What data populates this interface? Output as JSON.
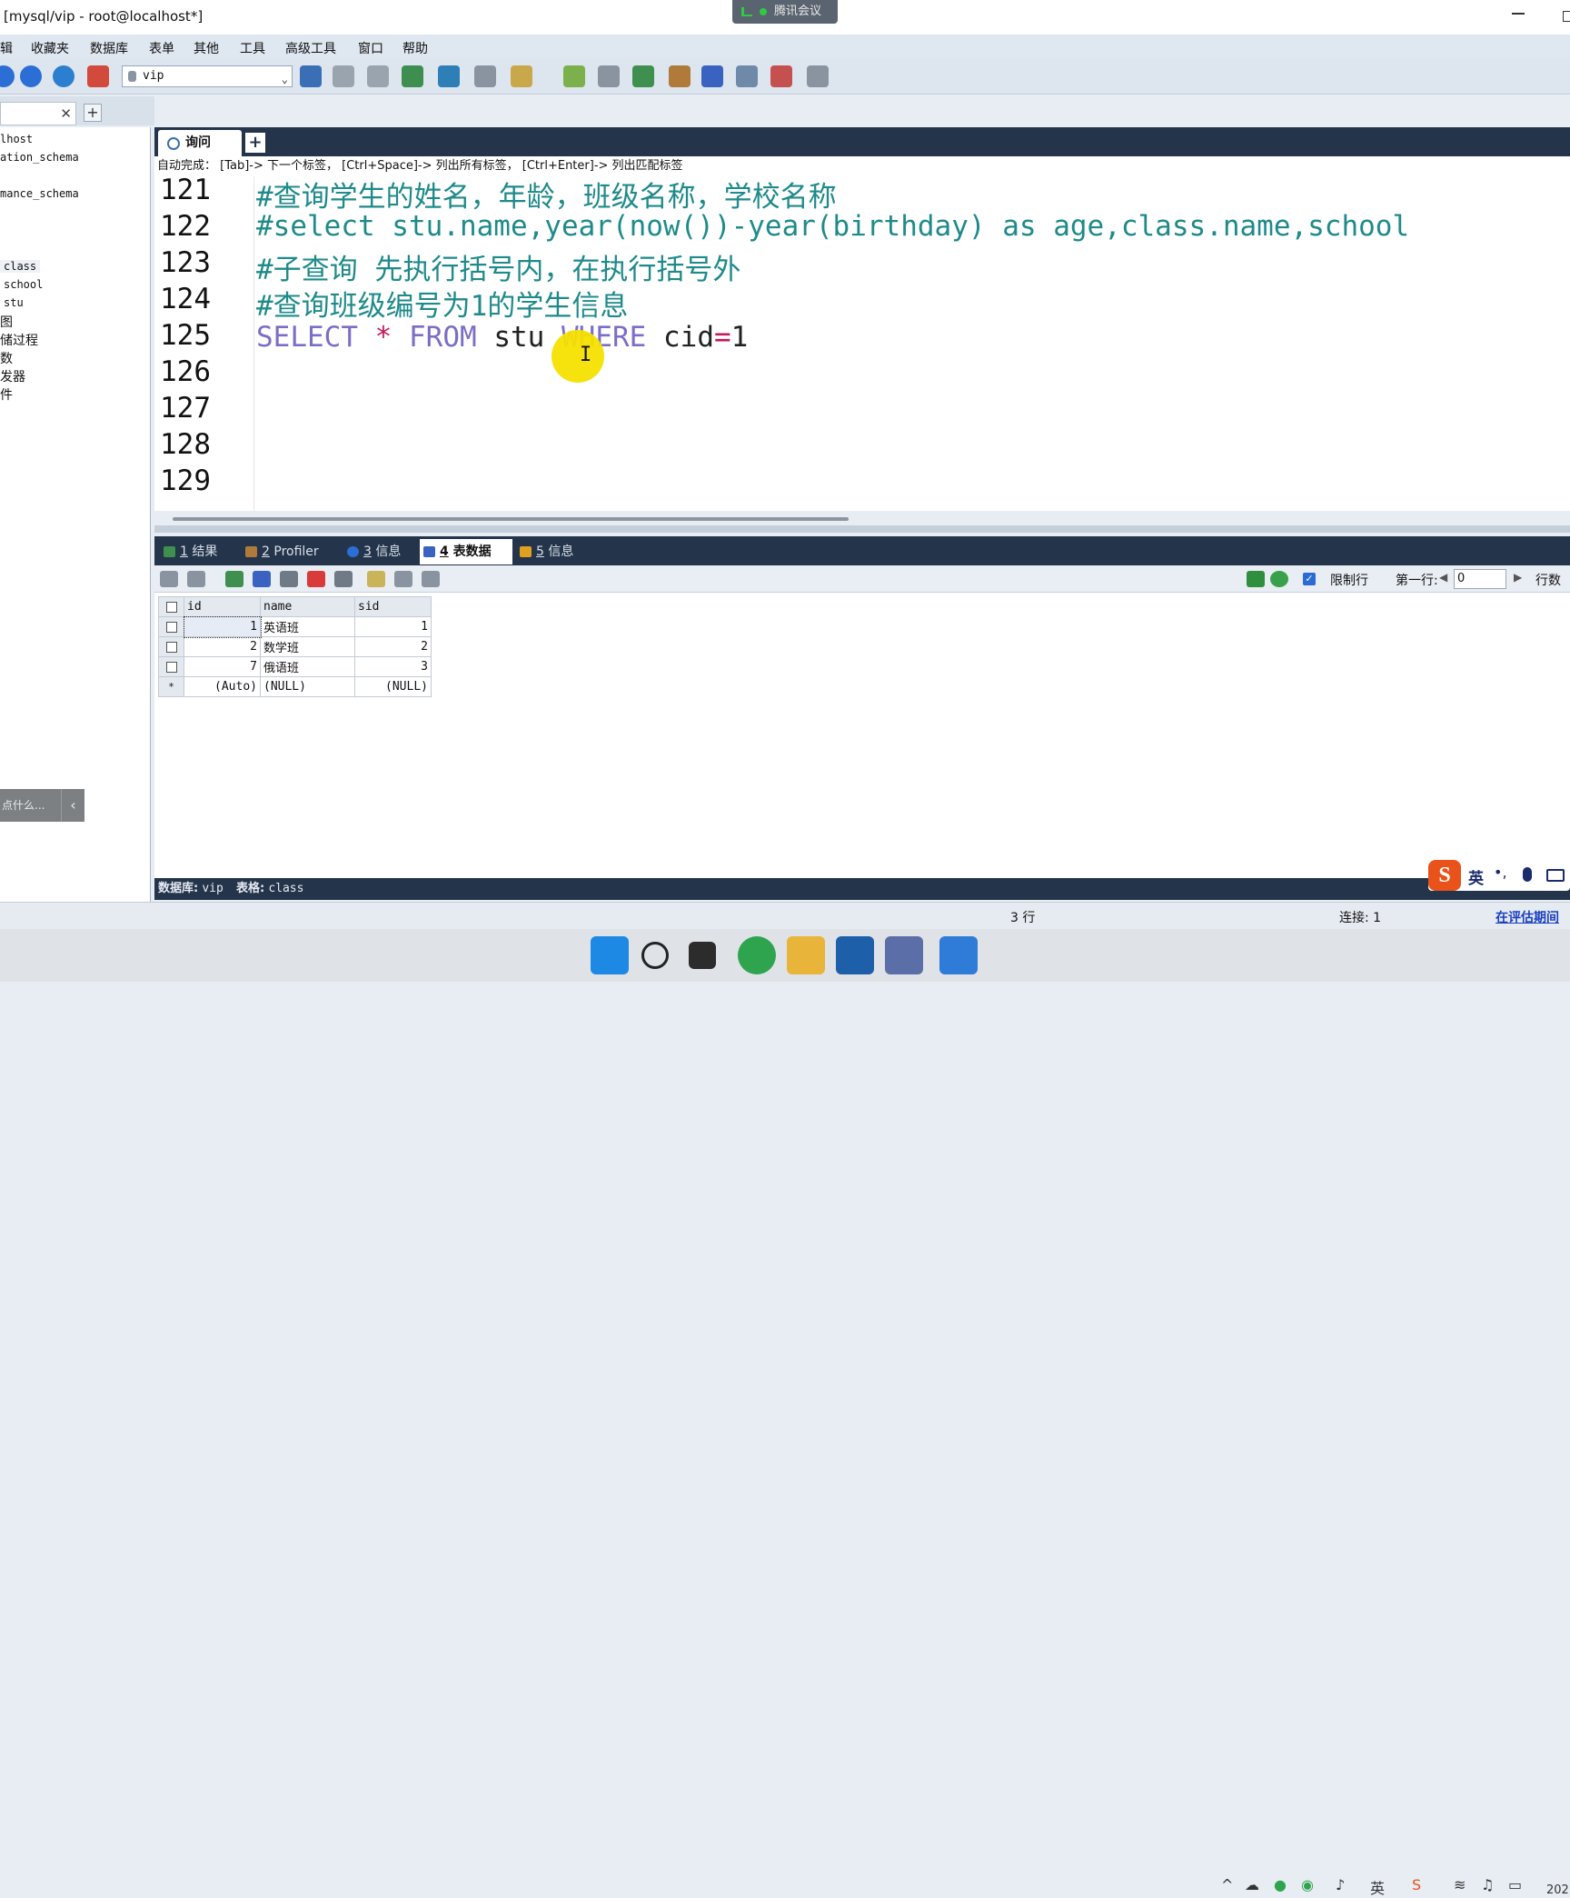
{
  "window": {
    "title": "[mysql/vip - root@localhost*]"
  },
  "meeting": {
    "label": "腾讯会议"
  },
  "menu": [
    "辑",
    "收藏夹",
    "数据库",
    "表单",
    "其他",
    "工具",
    "高级工具",
    "窗口",
    "帮助"
  ],
  "toolbar": {
    "db_selected": "vip"
  },
  "tree": {
    "items": [
      "lhost",
      "ation_schema",
      "mance_schema",
      "class",
      "school",
      "stu",
      "图",
      "储过程",
      "数",
      "发器",
      "件"
    ]
  },
  "hint_popup": {
    "text": "点什么..."
  },
  "query_tab": {
    "label": "询问"
  },
  "autocomplete_hint": "自动完成：  [Tab]-> 下一个标签， [Ctrl+Space]-> 列出所有标签， [Ctrl+Enter]-> 列出匹配标签",
  "editor": {
    "line_numbers": [
      "121",
      "122",
      "123",
      "124",
      "125",
      "126",
      "127",
      "128",
      "129"
    ],
    "lines": {
      "l121": "#查询学生的姓名，年龄，班级名称，学校名称",
      "l122": "#select stu.name,year(now())-year(birthday) as age,class.name,school",
      "l123": "#子查询   先执行括号内，在执行括号外",
      "l124": "#查询班级编号为1的学生信息",
      "l125": {
        "kw1": "SELECT",
        "star": "*",
        "kw2": "FROM",
        "table": "stu",
        "kw3": "WHERE",
        "col": "cid",
        "eq": "=",
        "val": "1"
      }
    }
  },
  "result_tabs": [
    {
      "num": "1",
      "label": "结果"
    },
    {
      "num": "2",
      "label": "Profiler"
    },
    {
      "num": "3",
      "label": "信息"
    },
    {
      "num": "4",
      "label": "表数据"
    },
    {
      "num": "5",
      "label": "信息"
    }
  ],
  "result_toolbar": {
    "limit_label": "限制行",
    "first_row_label": "第一行:",
    "first_row_value": "0",
    "rows_label": "行数"
  },
  "table": {
    "columns": [
      "id",
      "name",
      "sid"
    ],
    "rows": [
      {
        "id": "1",
        "name": "英语班",
        "sid": "1"
      },
      {
        "id": "2",
        "name": "数学班",
        "sid": "2"
      },
      {
        "id": "7",
        "name": "俄语班",
        "sid": "3"
      }
    ],
    "new_row": {
      "marker": "*",
      "id": "(Auto)",
      "name": "(NULL)",
      "sid": "(NULL)"
    }
  },
  "db_status": {
    "db_label": "数据库:",
    "db": "vip",
    "table_label": "表格:",
    "table": "class"
  },
  "ime": {
    "lang": "英"
  },
  "statusbar": {
    "rows": "3 行",
    "connections": "连接: 1",
    "evaluation": "在评估期间"
  },
  "taskbar": {
    "clock": "202"
  }
}
